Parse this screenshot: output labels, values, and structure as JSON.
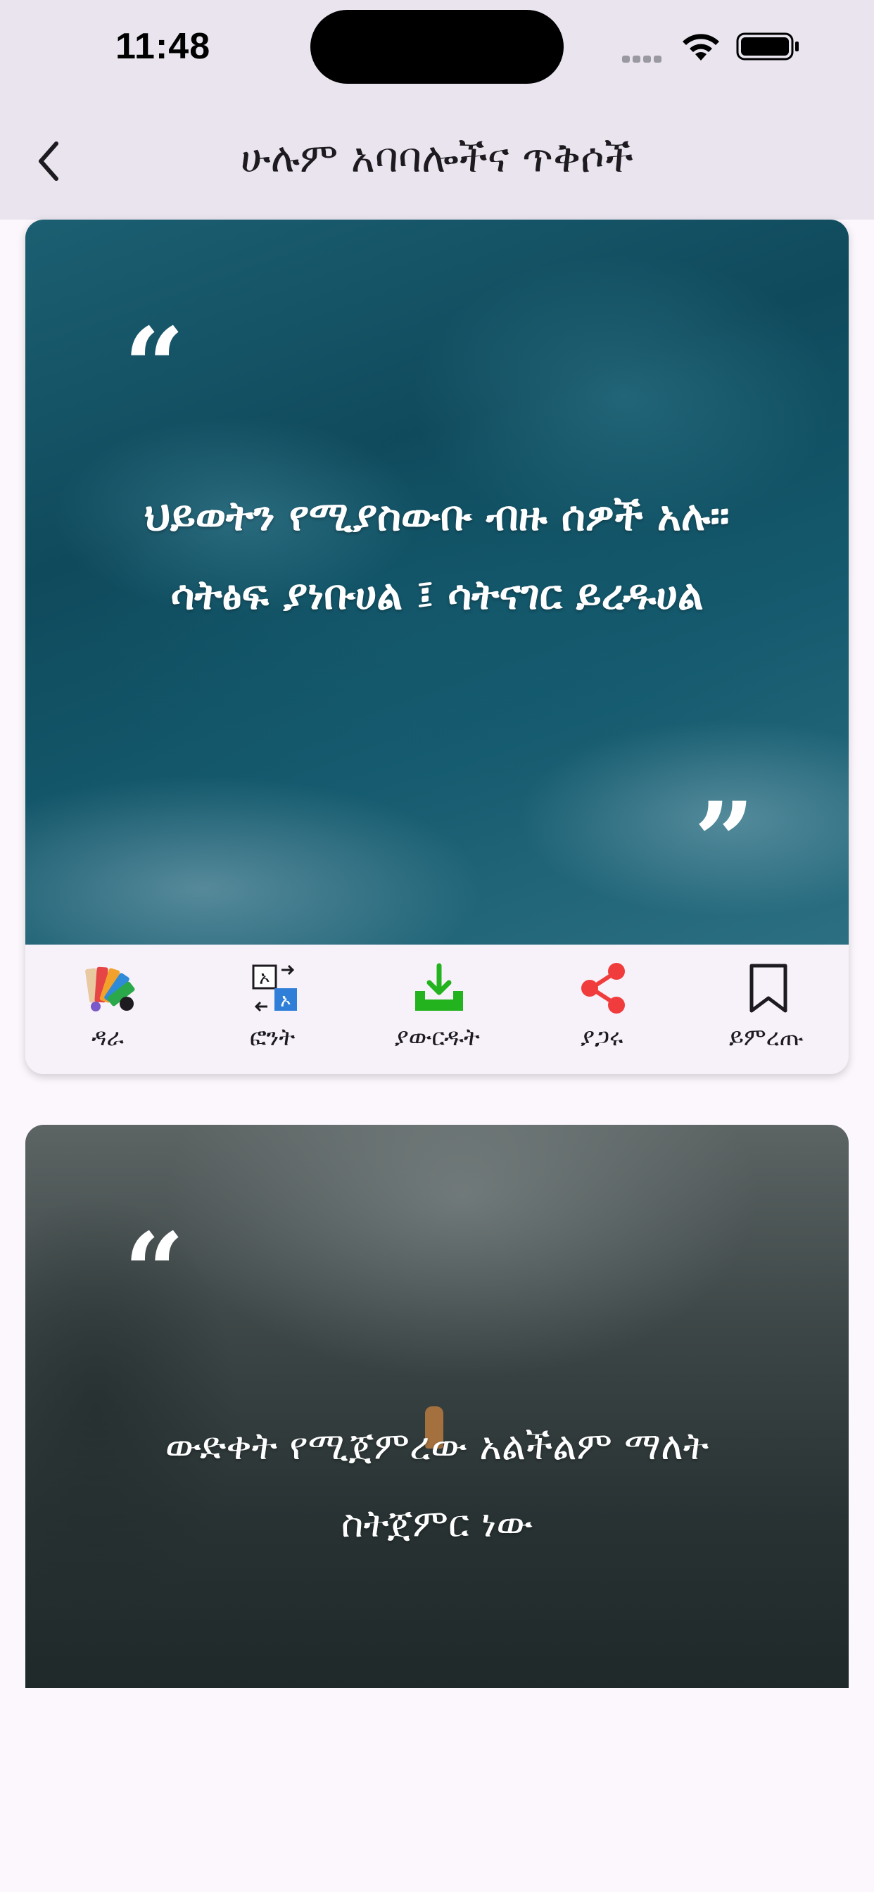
{
  "status_bar": {
    "time": "11:48"
  },
  "nav": {
    "title": "ሁሉም አባባሎችና ጥቅሶች",
    "back_icon": "chevron-left-icon"
  },
  "quotes": [
    {
      "open_mark": "“",
      "close_mark": "”",
      "text": "ህይወትን የሚያስውቡ ብዙ ሰዎች አሉ። ሳትፅፍ ያነቡሀል ፤ ሳትናገር ይረዱሀል",
      "theme": "ocean"
    },
    {
      "open_mark": "“",
      "text": "ውድቀት የሚጀምረው አልችልም ማለት ስትጀምር ነው",
      "theme": "foggy-forest"
    }
  ],
  "actions": [
    {
      "label": "ዳራ",
      "icon": "palette-icon"
    },
    {
      "label": "ፎንት",
      "icon": "font-icon"
    },
    {
      "label": "ያውርዱት",
      "icon": "download-icon",
      "color": "#22b31e"
    },
    {
      "label": "ያጋሩ",
      "icon": "share-icon",
      "color": "#f03c3c"
    },
    {
      "label": "ይምረጡ",
      "icon": "bookmark-icon"
    }
  ],
  "colors": {
    "header_bg": "#e9e4ee",
    "page_bg": "#fcf7fd",
    "action_bar_bg": "#f7f2fa"
  }
}
